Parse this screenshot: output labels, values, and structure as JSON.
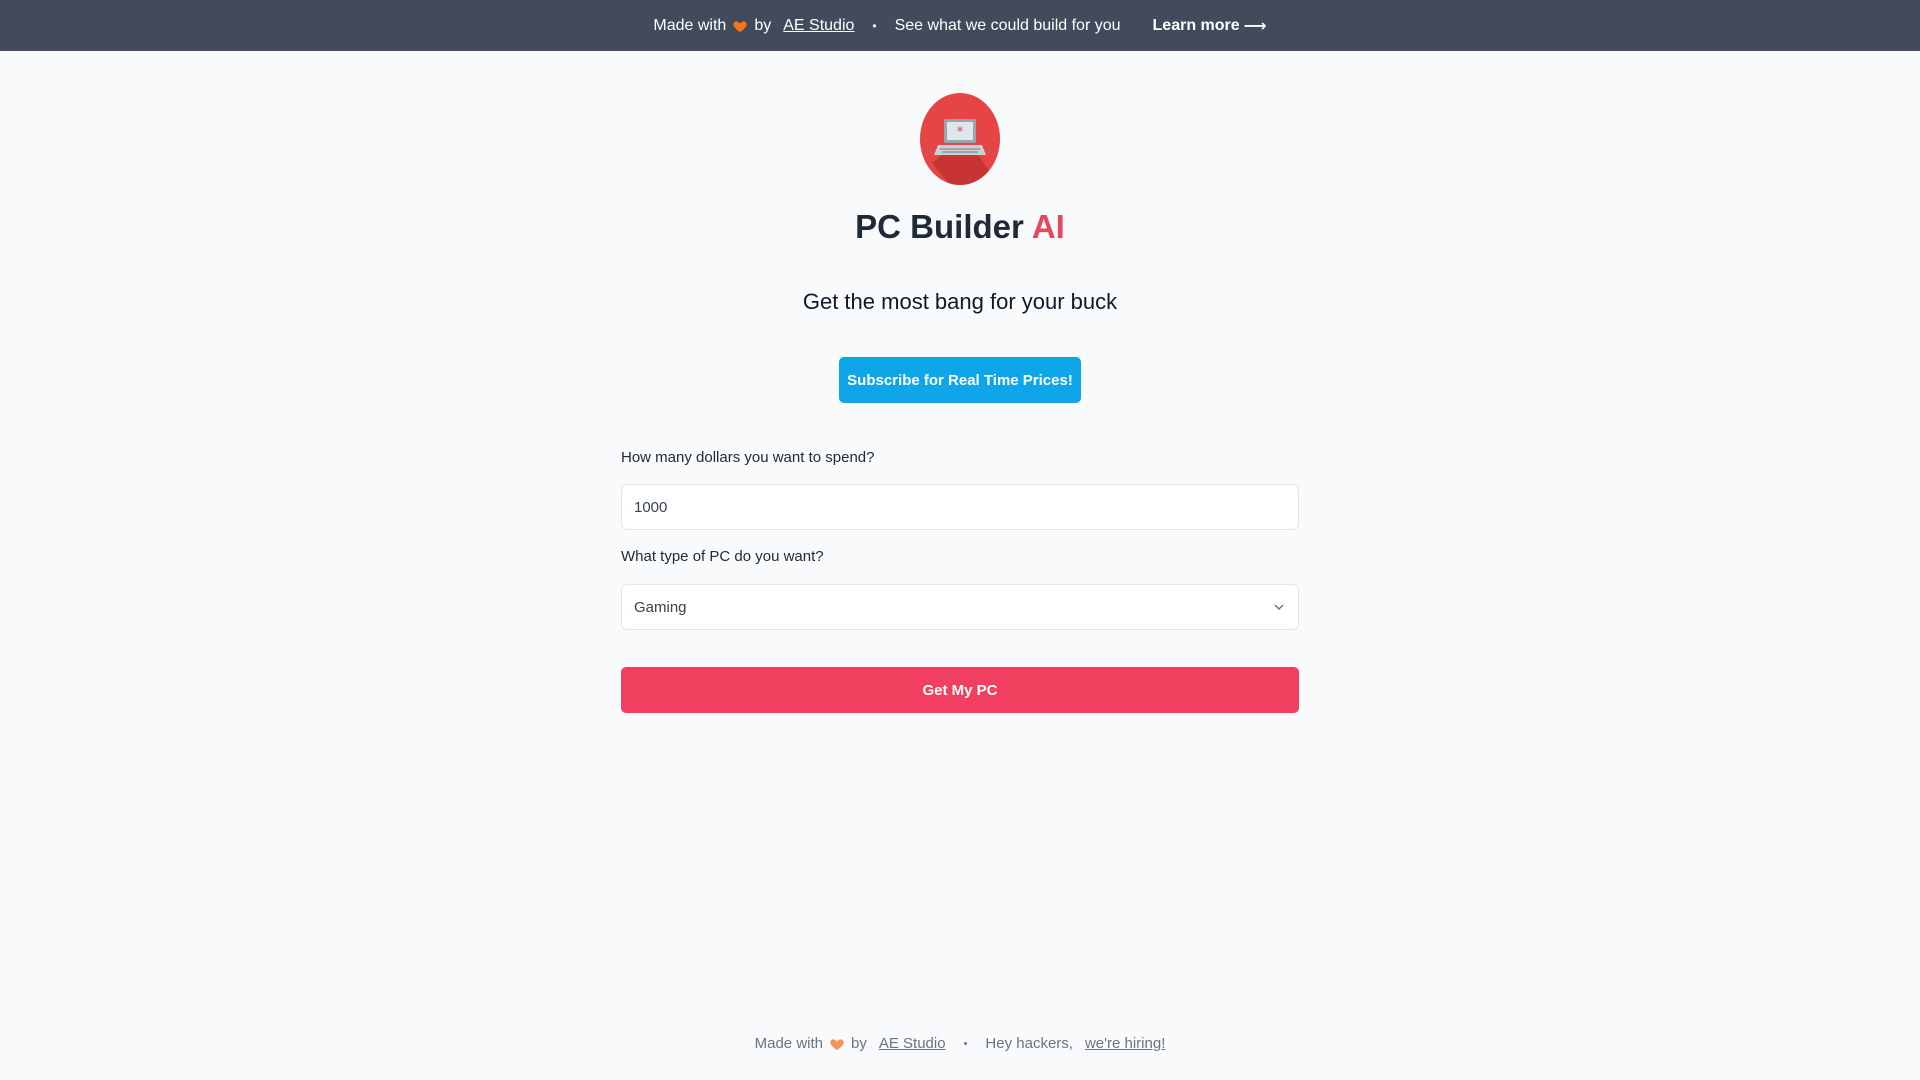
{
  "top_banner": {
    "made_with": "Made with",
    "by": "by",
    "studio_link": "AE Studio",
    "bullet": "•",
    "pitch": "See what we could build for you",
    "learn_more": "Learn more",
    "arrow": "⟶"
  },
  "brand": {
    "title_main": "PC Builder",
    "title_accent": "AI",
    "logo_icon": "laptop-icon"
  },
  "hero": {
    "tagline": "Get the most bang for your buck",
    "subscribe_label": "Subscribe for Real Time Prices!"
  },
  "form": {
    "budget_label": "How many dollars you want to spend?",
    "budget_value": "1000",
    "type_label": "What type of PC do you want?",
    "type_selected": "Gaming",
    "submit_label": "Get My PC"
  },
  "footer": {
    "made_with": "Made with",
    "by": "by",
    "studio_link": "AE Studio",
    "bullet": "•",
    "hey": "Hey hackers,",
    "hiring_link": "we're hiring!"
  },
  "colors": {
    "banner_bg": "#414b5b",
    "accent_red": "#e4485f",
    "subscribe_blue": "#0ea5e9",
    "submit_red": "#f1405f",
    "heart_orange": "#f97316"
  }
}
